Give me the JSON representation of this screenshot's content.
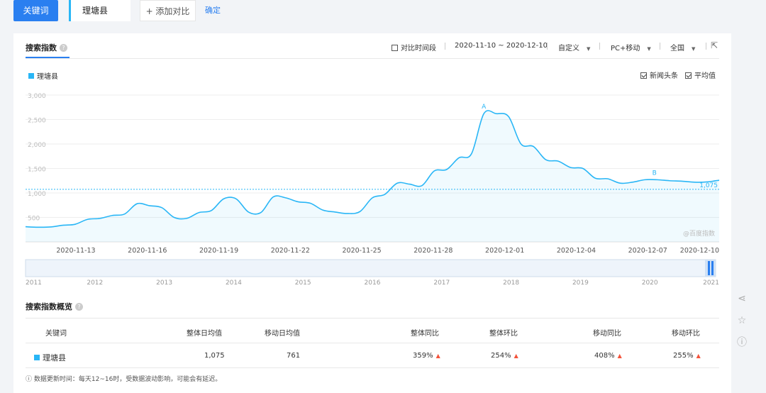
{
  "topbar": {
    "keyword_button": "关键词",
    "keyword": "理塘县",
    "add_compare": "+ 添加对比",
    "confirm": "确定"
  },
  "card": {
    "tab_title": "搜索指数",
    "compare_period": "对比时间段",
    "date_range": "2020-11-10 ~ 2020-12-10",
    "custom": "自定义",
    "device": "PC+移动",
    "region": "全国",
    "news_headlines": "新闻头条",
    "average": "平均值",
    "watermark": "@百度指数",
    "annotation_a": "A",
    "annotation_b": "B",
    "avg_label": "1,075"
  },
  "colors": {
    "accent": "#2a7ff0",
    "series": "#29b6f6",
    "up_arrow": "#f4533b"
  },
  "chart_data": {
    "type": "area",
    "title": "",
    "series": [
      {
        "name": "理塘县",
        "values": [
          310,
          300,
          305,
          340,
          360,
          460,
          480,
          540,
          570,
          780,
          740,
          700,
          500,
          480,
          600,
          640,
          880,
          880,
          610,
          600,
          920,
          900,
          820,
          790,
          650,
          610,
          580,
          620,
          900,
          970,
          1200,
          1180,
          1150,
          1450,
          1480,
          1720,
          1800,
          2620,
          2620,
          2560,
          2000,
          1950,
          1680,
          1650,
          1520,
          1500,
          1300,
          1290,
          1200,
          1220,
          1270,
          1270,
          1250,
          1240,
          1220,
          1225,
          1260
        ]
      }
    ],
    "x_start": "2020-11-10",
    "x_end": "2020-12-10",
    "x_ticks": [
      "2020-11-13",
      "2020-11-16",
      "2020-11-19",
      "2020-11-22",
      "2020-11-25",
      "2020-11-28",
      "2020-12-01",
      "2020-12-04",
      "2020-12-07",
      "2020-12-10"
    ],
    "y_ticks": [
      "3,000",
      "2,500",
      "2,000",
      "1,500",
      "1,000",
      "500"
    ],
    "ylim": [
      0,
      3000
    ],
    "average": 1075,
    "overview_years": [
      "2011",
      "2012",
      "2013",
      "2014",
      "2015",
      "2016",
      "2017",
      "2018",
      "2019",
      "2020",
      "2021"
    ]
  },
  "summary": {
    "title": "搜索指数概览",
    "headers": [
      "关键词",
      "整体日均值",
      "移动日均值",
      "整体同比",
      "整体环比",
      "移动同比",
      "移动环比"
    ],
    "row": {
      "keyword": "理塘县",
      "overall_avg": "1,075",
      "mobile_avg": "761",
      "overall_yoy": "359%",
      "overall_mom": "254%",
      "mobile_yoy": "408%",
      "mobile_mom": "255%"
    },
    "up_arrow": "▲",
    "note": "ⓘ 数据更新时间：每天12~16时，受数据波动影响，可能会有延迟。"
  }
}
